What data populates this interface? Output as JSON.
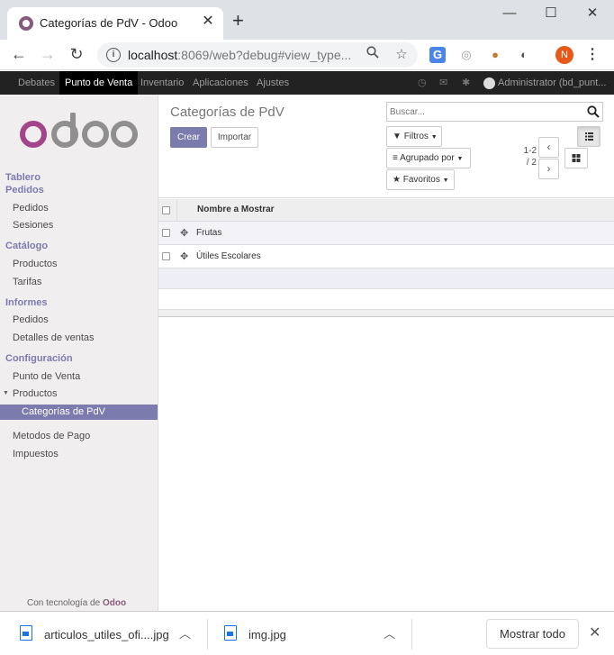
{
  "browser": {
    "tab_title": "Categorías de PdV - Odoo",
    "url_host": "localhost",
    "url_rest": ":8069/web?debug#view_type...",
    "profile_initial": "N",
    "accent": "#875a7b"
  },
  "odoo_nav": {
    "items": [
      "Debates",
      "Punto de Venta",
      "Inventario",
      "Aplicaciones",
      "Ajustes"
    ],
    "active": "Punto de Venta",
    "user": "Administrator (bd_punt..."
  },
  "sidebar": {
    "logo_text": "odoo",
    "sections": [
      {
        "heading": "Tablero"
      },
      {
        "heading": "Pedidos",
        "items": [
          "Pedidos",
          "Sesiones"
        ]
      },
      {
        "heading": "Catálogo",
        "items": [
          "Productos",
          "Tarifas"
        ]
      },
      {
        "heading": "Informes",
        "items": [
          "Pedidos",
          "Detalles de ventas"
        ]
      },
      {
        "heading": "Configuración",
        "items": [
          "Punto de Venta",
          "Productos",
          "Categorías de PdV",
          "Metodos de Pago",
          "Impuestos"
        ]
      }
    ],
    "active_item": "Categorías de PdV",
    "powered_prefix": "Con tecnología de",
    "powered_brand": "Odoo",
    "brand_color": "#7c7bad"
  },
  "control_panel": {
    "title": "Categorías de PdV",
    "create_label": "Crear",
    "import_label": "Importar",
    "search_placeholder": "Buscar...",
    "filters_label": "Filtros",
    "groupby_label": "Agrupado por",
    "favorites_label": "Favoritos",
    "pager_range": "1-2",
    "pager_total": "/ 2"
  },
  "list": {
    "column_header": "Nombre a Mostrar",
    "rows": [
      "Frutas",
      "Útiles Escolares"
    ]
  },
  "downloads": {
    "files": [
      "articulos_utiles_ofi....jpg",
      "img.jpg"
    ],
    "show_all_label": "Mostrar todo"
  }
}
